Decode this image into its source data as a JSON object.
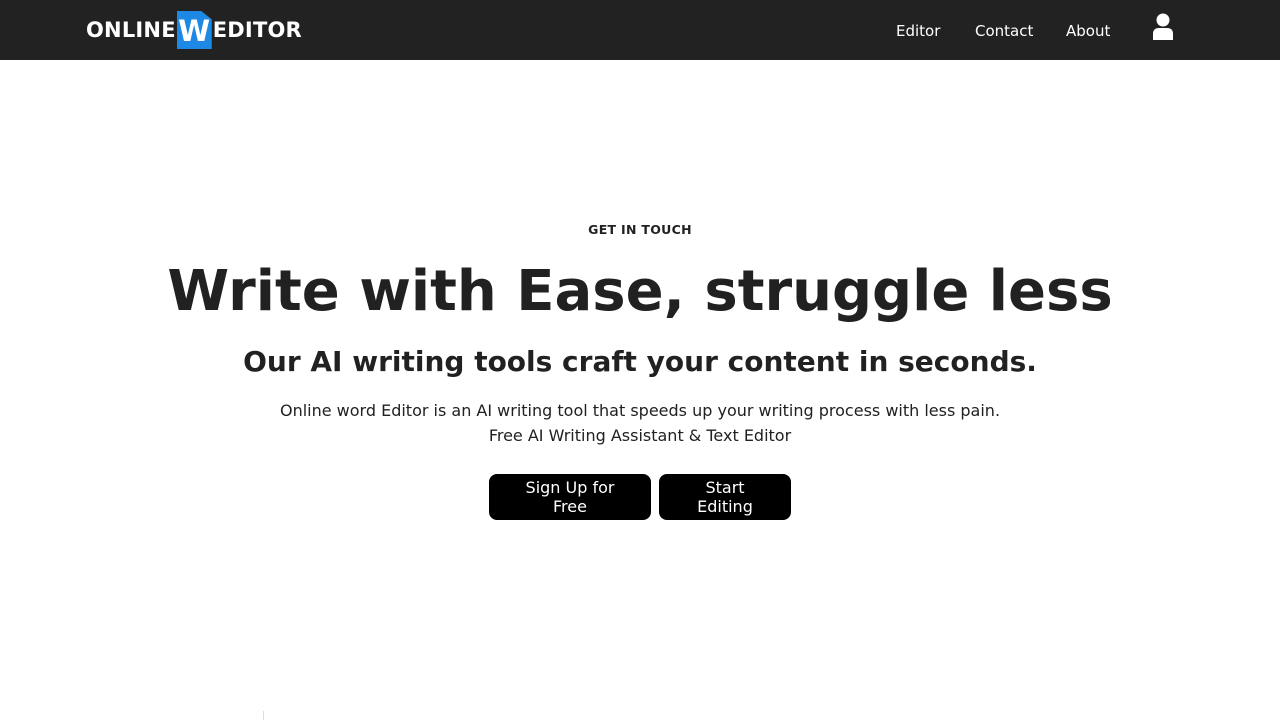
{
  "navbar": {
    "logo": {
      "prefix": "ONLINE",
      "badge_letter": "W",
      "suffix": "EDITOR",
      "badge_color": "#1e88e5"
    },
    "links": [
      {
        "label": "Editor"
      },
      {
        "label": "Contact"
      },
      {
        "label": "About"
      }
    ],
    "user_icon": "user-icon",
    "background": "#222222"
  },
  "hero": {
    "eyebrow": "GET IN TOUCH",
    "headline": "Write with Ease, struggle less",
    "subheadline": "Our AI writing tools craft your content in seconds.",
    "description_line_1": "Online word Editor is an AI writing tool that speeds up your writing process with less pain.",
    "description_line_2": "Free AI Writing Assistant & Text Editor",
    "buttons": {
      "signup": "Sign Up for Free",
      "start": "Start Editing"
    }
  }
}
